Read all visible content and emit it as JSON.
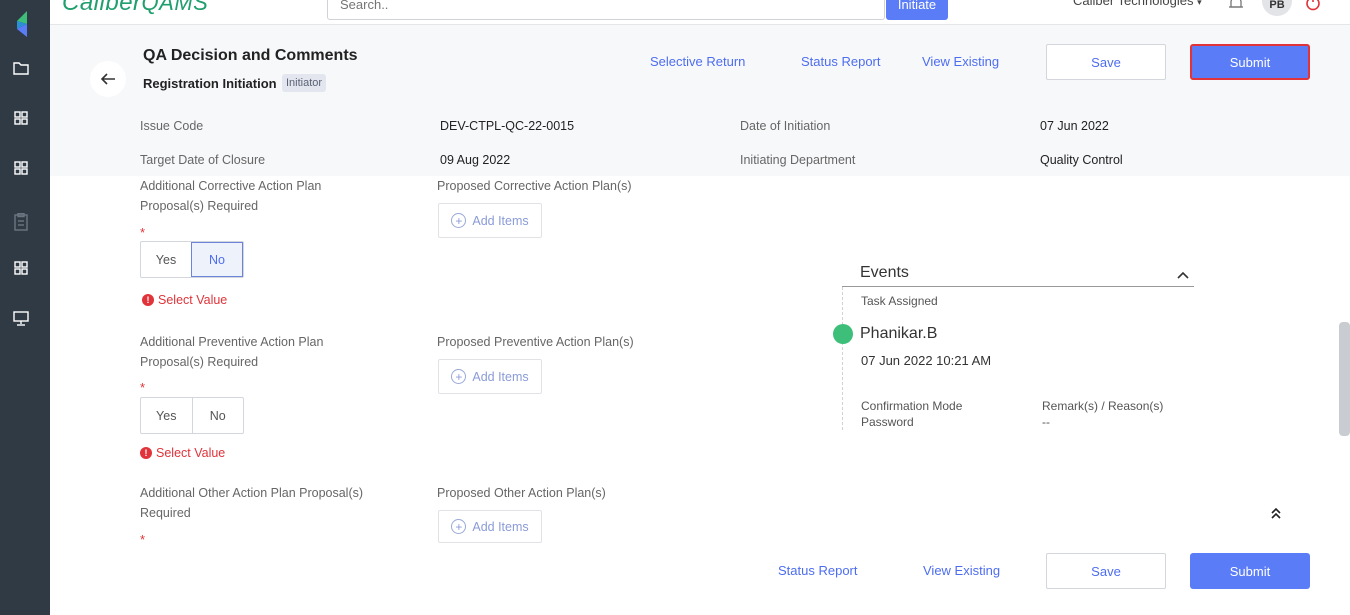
{
  "app": {
    "brand_prefix": "Caliber",
    "brand_suffix": "QAMS",
    "search_placeholder": "Search..",
    "initiate_label": "Initiate",
    "company": "Caliber Technologies",
    "user_initials": "PB",
    "accent_color": "#5b7cf7"
  },
  "sidebar": {
    "icons": [
      "logo-icon",
      "folder-icon",
      "grid-icon",
      "grid-icon",
      "clipboard-icon",
      "grid-icon",
      "monitor-icon"
    ]
  },
  "header": {
    "title": "QA Decision and Comments",
    "subtitle": "Registration Initiation",
    "badge": "Initiator",
    "links": {
      "selective_return": "Selective Return",
      "status_report": "Status Report",
      "view_existing": "View Existing"
    },
    "save_label": "Save",
    "submit_label": "Submit"
  },
  "meta": {
    "issue_code_label": "Issue Code",
    "issue_code": "DEV-CTPL-QC-22-0015",
    "date_of_initiation_label": "Date of Initiation",
    "date_of_initiation": "07 Jun 2022",
    "target_date_label": "Target Date of Closure",
    "target_date": "09 Aug 2022",
    "initiating_dept_label": "Initiating Department",
    "initiating_dept": "Quality Control"
  },
  "form": {
    "corrective": {
      "label_line1": "Additional Corrective Action Plan",
      "label_line2": "Proposal(s) Required",
      "plans_label": "Proposed Corrective Action Plan(s)",
      "selected": "No"
    },
    "preventive": {
      "label_line1": "Additional Preventive Action Plan",
      "label_line2": "Proposal(s) Required",
      "plans_label": "Proposed Preventive Action Plan(s)",
      "selected": ""
    },
    "other": {
      "label_line1": "Additional Other Action Plan Proposal(s)",
      "label_line2": "Required",
      "plans_label": "Proposed Other Action Plan(s)"
    },
    "required_marker": "*",
    "yes_label": "Yes",
    "no_label": "No",
    "error_text": "Select Value",
    "add_items_label": "Add Items"
  },
  "events": {
    "title": "Events",
    "task_label": "Task Assigned",
    "user": "Phanikar.B",
    "datetime": "07 Jun 2022 10:21 AM",
    "confirmation_label": "Confirmation Mode",
    "confirmation_value": "Password",
    "remarks_label": "Remark(s) / Reason(s)",
    "remarks_value": "--"
  },
  "footer": {
    "status_report": "Status Report",
    "view_existing": "View Existing",
    "save_label": "Save",
    "submit_label": "Submit"
  }
}
